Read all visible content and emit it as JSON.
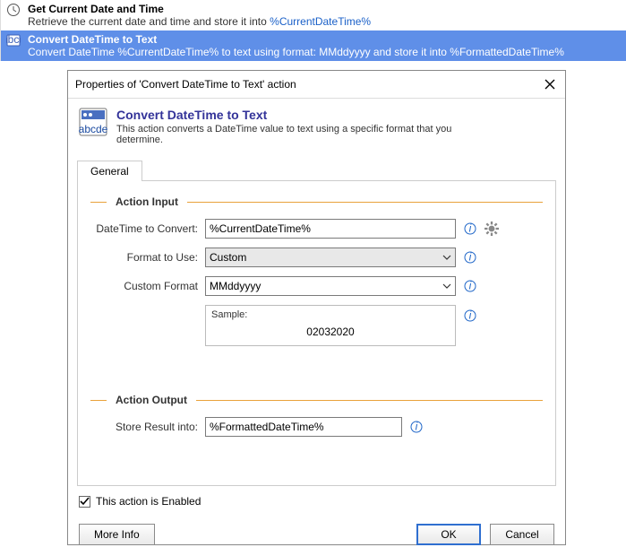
{
  "flow": {
    "step1": {
      "title": "Get Current Date and Time",
      "desc_pre": "Retrieve the current date and time and store it into ",
      "var": "%CurrentDateTime%"
    },
    "step2": {
      "title": "Convert DateTime to Text",
      "desc_pre": "Convert DateTime ",
      "var1": "%CurrentDateTime%",
      "desc_mid": " to text using format: MMddyyyy and store it into ",
      "var2": "%FormattedDateTime%"
    }
  },
  "dialog": {
    "title": "Properties of 'Convert DateTime to Text' action",
    "header_title": "Convert DateTime to Text",
    "header_desc": "This action converts a DateTime value to text using a specific format that you determine.",
    "tab_general": "General",
    "section_input": "Action Input",
    "section_output": "Action Output",
    "labels": {
      "dt_to_convert": "DateTime to Convert:",
      "format_to_use": "Format to Use:",
      "custom_format": "Custom Format",
      "sample": "Sample:",
      "store_result": "Store Result into:"
    },
    "values": {
      "dt_to_convert": "%CurrentDateTime%",
      "format_to_use": "Custom",
      "custom_format": "MMddyyyy",
      "sample": "02032020",
      "store_result": "%FormattedDateTime%"
    },
    "enabled_label": "This action is Enabled",
    "enabled_checked": true,
    "buttons": {
      "more": "More Info",
      "ok": "OK",
      "cancel": "Cancel"
    }
  }
}
